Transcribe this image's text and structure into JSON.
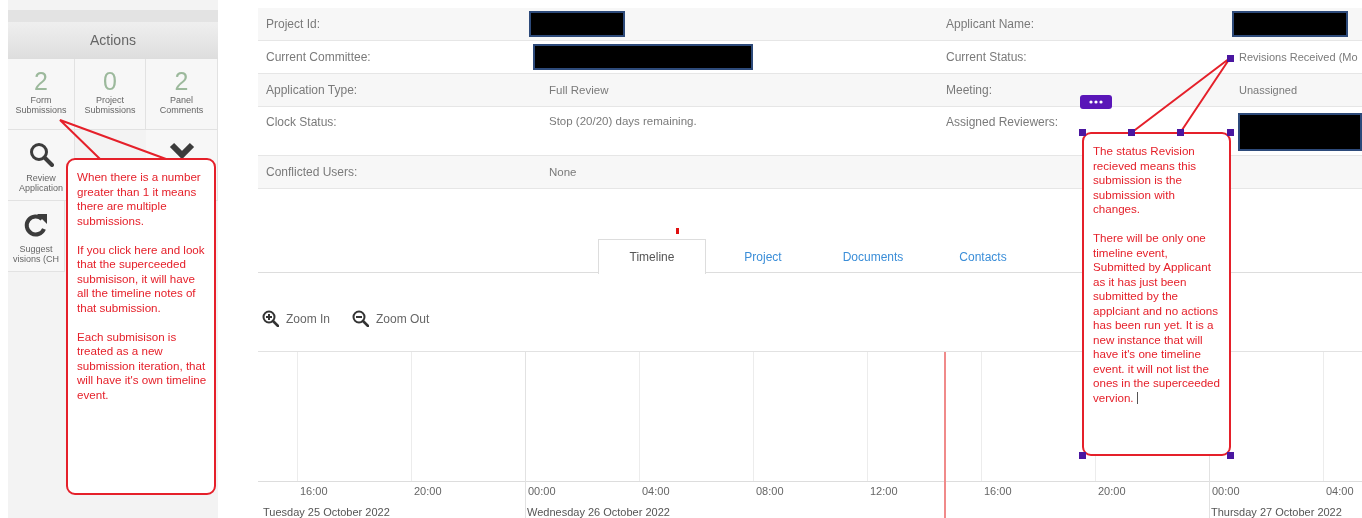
{
  "sidebar": {
    "title": "Actions",
    "counters": [
      {
        "count": "2",
        "lines": [
          "Form",
          "Submissions"
        ]
      },
      {
        "count": "0",
        "lines": [
          "Project",
          "Submissions"
        ]
      },
      {
        "count": "2",
        "lines": [
          "Panel",
          "Comments"
        ]
      }
    ],
    "actions": [
      {
        "kind": "search",
        "lines": [
          "Review",
          "Application"
        ]
      },
      {
        "kind": "empty"
      },
      {
        "kind": "chevron"
      },
      {
        "kind": "redo",
        "lines": [
          "Suggest",
          "visions (CH"
        ]
      }
    ]
  },
  "details": [
    {
      "left": {
        "label": "Project Id:",
        "redacted": true
      },
      "right": {
        "label": "Applicant Name:",
        "redacted": true
      }
    },
    {
      "left": {
        "label": "Current Committee:",
        "redacted": true
      },
      "right": {
        "label": "Current Status:",
        "redacted": false,
        "value": "Revisions Received (Mo"
      }
    },
    {
      "left": {
        "label": "Application Type:",
        "redacted": false,
        "value": "Full Review"
      },
      "right": {
        "label": "Meeting:",
        "redacted": false,
        "value": "Unassigned"
      }
    },
    {
      "left": {
        "label": "Clock Status:",
        "redacted": false,
        "value": "Stop (20/20) days remaining."
      },
      "right": {
        "label": "Assigned Reviewers:",
        "redacted": true
      }
    },
    {
      "left": {
        "label": "Conflicted Users:",
        "redacted": false,
        "value": "None"
      }
    }
  ],
  "tabs": [
    {
      "label": "Timeline",
      "selected": true
    },
    {
      "label": "Project",
      "selected": false
    },
    {
      "label": "Documents",
      "selected": false
    },
    {
      "label": "Contacts",
      "selected": false
    }
  ],
  "zoom_controls": [
    {
      "kind": "in",
      "label": "Zoom In"
    },
    {
      "kind": "out",
      "label": "Zoom Out"
    }
  ],
  "timeline": {
    "ticks": [
      {
        "time": "16:00",
        "date": "Tuesday 25 October 2022"
      },
      {
        "time": "20:00"
      },
      {
        "time": "00:00",
        "date": "Wednesday 26 October 2022"
      },
      {
        "time": "04:00"
      },
      {
        "time": "08:00"
      },
      {
        "time": "12:00"
      },
      {
        "time": "16:00"
      },
      {
        "time": "20:00"
      },
      {
        "time": "00:00",
        "date": "Thursday 27 October 2022"
      },
      {
        "time": "04:00"
      }
    ]
  },
  "callouts": [
    {
      "paragraphs": [
        "When there is a number greater than 1 it means there are multiple submissions.",
        "If you click here and look that the superceeded submisison, it will have all the timeline notes of that submission.",
        "Each submisison is treated as a new submission iteration, that will have it's own timeline event."
      ],
      "editing": false
    },
    {
      "paragraphs": [
        "The status Revision recieved means this submission is the submission with changes.",
        "There will be only one timeline event, Submitted by Applicant as it has just been submitted by the applciant and no actions has been run yet. It is a new instance that will have it's one timeline event. it will not list the ones in the superceeded vervion."
      ],
      "editing": true
    }
  ]
}
